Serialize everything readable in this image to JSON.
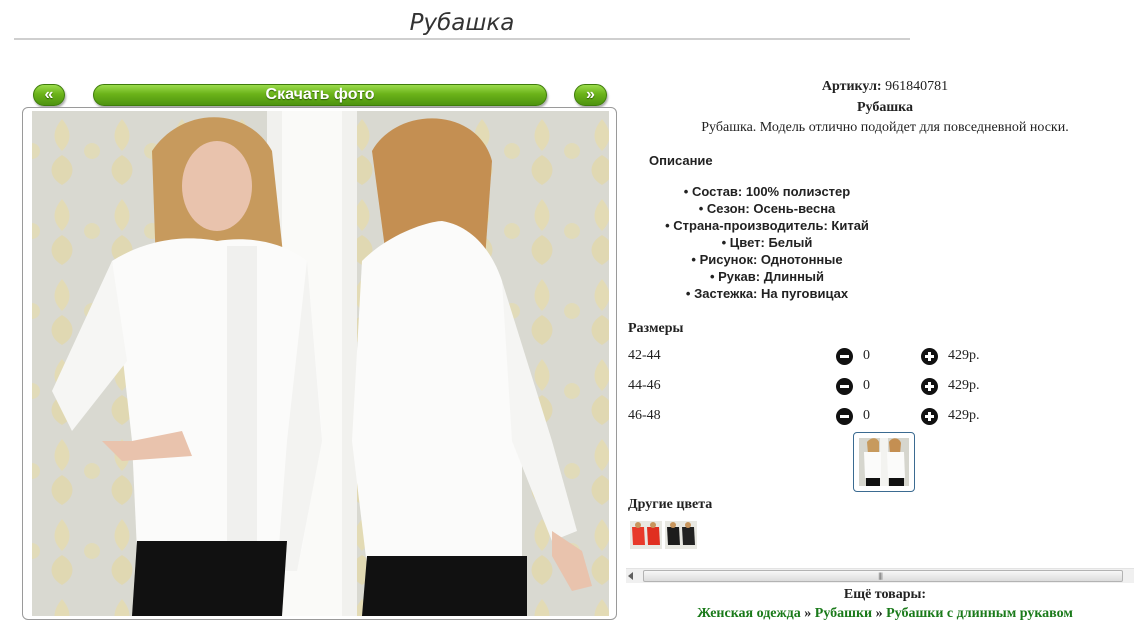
{
  "page": {
    "title": "Рубашка"
  },
  "gallery": {
    "prev_label": "«",
    "download_label": "Скачать фото",
    "next_label": "»"
  },
  "product": {
    "sku_label": "Артикул:",
    "sku_value": "961840781",
    "name": "Рубашка",
    "short_description": "Рубашка. Модель отлично подойдет для повседневной носки.",
    "description_heading": "Описание",
    "properties": [
      "Состав: 100% полиэстер",
      "Сезон: Осень-весна",
      "Страна-производитель: Китай",
      "Цвет: Белый",
      "Рисунок: Однотонные",
      "Рукав: Длинный",
      "Застежка: На пуговицах"
    ]
  },
  "sizes": {
    "heading": "Размеры",
    "rows": [
      {
        "size": "42-44",
        "qty": "0",
        "price": "429р."
      },
      {
        "size": "44-46",
        "qty": "0",
        "price": "429р."
      },
      {
        "size": "46-48",
        "qty": "0",
        "price": "429р."
      }
    ]
  },
  "other_colors": {
    "heading": "Другие цвета",
    "swatches": [
      "red",
      "black"
    ]
  },
  "more": {
    "heading": "Ещё товары:",
    "crumbs": [
      "Женская одежда",
      "Рубашки",
      "Рубашки с длинным рукавом"
    ],
    "separator": "»"
  },
  "colors": {
    "accent_green": "#6bb319",
    "link_green": "#1a7a1a"
  }
}
